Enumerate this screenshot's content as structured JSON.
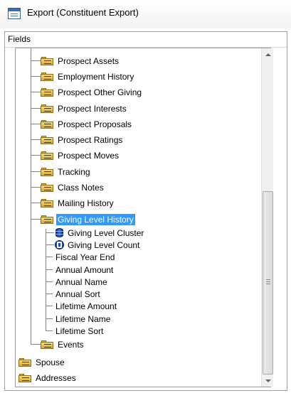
{
  "window": {
    "title": "Export (Constituent Export)"
  },
  "fields_group": {
    "label": "Fields"
  },
  "tree": {
    "items": [
      {
        "label": "Prospect Assets",
        "icon": "folder-icon"
      },
      {
        "label": "Employment History",
        "icon": "folder-icon"
      },
      {
        "label": "Prospect Other Giving",
        "icon": "folder-icon"
      },
      {
        "label": "Prospect Interests",
        "icon": "folder-icon"
      },
      {
        "label": "Prospect Proposals",
        "icon": "folder-icon"
      },
      {
        "label": "Prospect Ratings",
        "icon": "folder-icon"
      },
      {
        "label": "Prospect Moves",
        "icon": "folder-icon"
      },
      {
        "label": "Tracking",
        "icon": "folder-icon"
      },
      {
        "label": "Class Notes",
        "icon": "folder-icon"
      },
      {
        "label": "Mailing History",
        "icon": "folder-icon"
      },
      {
        "label": "Giving Level History",
        "icon": "folder-icon",
        "selected": true
      },
      {
        "label": "Events",
        "icon": "folder-icon"
      },
      {
        "label": "Spouse",
        "icon": "folder-icon"
      },
      {
        "label": "Addresses",
        "icon": "folder-icon"
      }
    ],
    "giving_level_children": [
      {
        "label": "Giving Level Cluster",
        "icon": "database-icon"
      },
      {
        "label": "Giving Level Count",
        "icon": "count-icon"
      },
      {
        "label": "Fiscal Year End",
        "icon": ""
      },
      {
        "label": "Annual Amount",
        "icon": ""
      },
      {
        "label": "Annual Name",
        "icon": ""
      },
      {
        "label": "Annual Sort",
        "icon": ""
      },
      {
        "label": "Lifetime Amount",
        "icon": ""
      },
      {
        "label": "Lifetime Name",
        "icon": ""
      },
      {
        "label": "Lifetime Sort",
        "icon": ""
      }
    ]
  },
  "colors": {
    "selection": "#3399ff",
    "folder": "#e8c24a"
  }
}
